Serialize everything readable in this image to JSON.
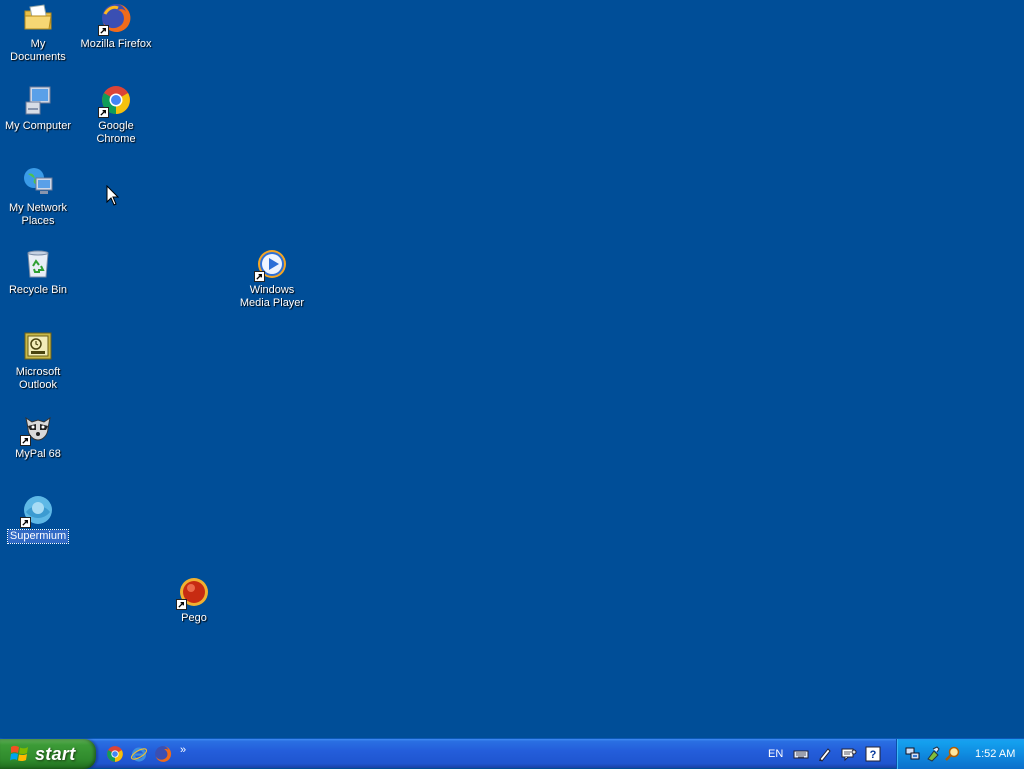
{
  "desktop": {
    "background_color": "#004e98",
    "icons": [
      {
        "name": "my-documents",
        "label": "My Documents",
        "icon": "folder-documents-icon",
        "shortcut": false,
        "selected": false
      },
      {
        "name": "mozilla-firefox",
        "label": "Mozilla Firefox",
        "icon": "firefox-icon",
        "shortcut": true,
        "selected": false
      },
      {
        "name": "my-computer",
        "label": "My Computer",
        "icon": "computer-icon",
        "shortcut": false,
        "selected": false
      },
      {
        "name": "google-chrome",
        "label": "Google Chrome",
        "icon": "chrome-icon",
        "shortcut": true,
        "selected": false
      },
      {
        "name": "my-network-places",
        "label": "My Network Places",
        "icon": "network-icon",
        "shortcut": false,
        "selected": false
      },
      {
        "name": "recycle-bin",
        "label": "Recycle Bin",
        "icon": "recycle-bin-icon",
        "shortcut": false,
        "selected": false
      },
      {
        "name": "windows-media-player",
        "label": "Windows Media Player",
        "icon": "media-player-icon",
        "shortcut": true,
        "selected": false
      },
      {
        "name": "microsoft-outlook",
        "label": "Microsoft Outlook",
        "icon": "outlook-icon",
        "shortcut": false,
        "selected": false
      },
      {
        "name": "mypal-68",
        "label": "MyPal 68",
        "icon": "mypal-raccoon-icon",
        "shortcut": true,
        "selected": false
      },
      {
        "name": "supermium",
        "label": "Supermium",
        "icon": "supermium-icon",
        "shortcut": true,
        "selected": true
      },
      {
        "name": "pego",
        "label": "Pego",
        "icon": "pego-icon",
        "shortcut": true,
        "selected": false
      }
    ]
  },
  "taskbar": {
    "start_label": "start",
    "quick_launch": [
      "chrome-icon",
      "internet-explorer-icon",
      "firefox-icon"
    ],
    "quick_launch_more": "»",
    "language": "EN",
    "language_bar_icons": [
      "keyboard-icon",
      "pen-icon",
      "speech-icon",
      "help-icon"
    ],
    "tray_icons": [
      "network-connection-icon",
      "safely-remove-icon",
      "search-icon"
    ],
    "clock": "1:52 AM",
    "colors": {
      "taskbar": "#245edb",
      "start": "#3c9b37",
      "tray": "#0f8be0"
    }
  }
}
